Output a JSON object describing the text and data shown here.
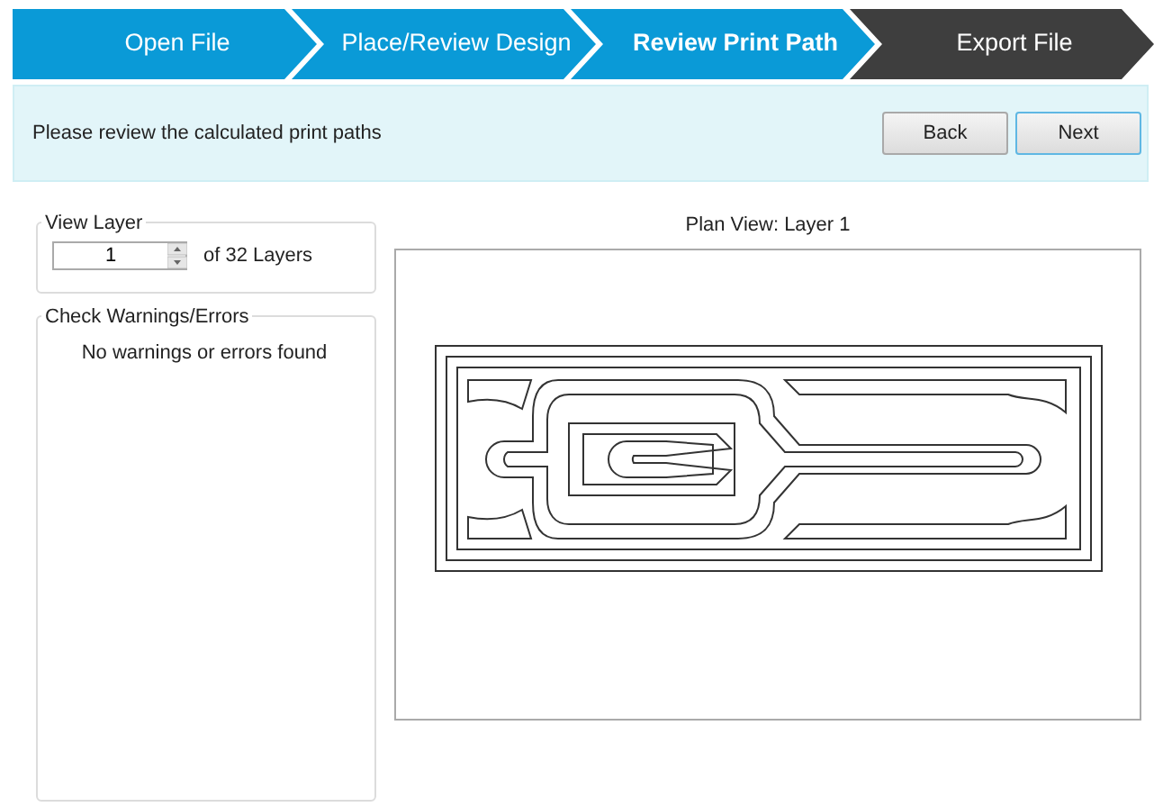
{
  "steps": [
    {
      "label": "Open File",
      "selected": false
    },
    {
      "label": "Place/Review Design",
      "selected": false
    },
    {
      "label": "Review Print Path",
      "selected": true
    },
    {
      "label": "Export File",
      "selected": false
    }
  ],
  "instruction": "Please review the calculated print paths",
  "buttons": [
    {
      "label": "Back",
      "selected": false
    },
    {
      "label": "Next",
      "selected": true
    }
  ],
  "view_layer": {
    "title": "View Layer",
    "value": "1",
    "suffix": "of 32 Layers"
  },
  "warnings": {
    "title": "Check Warnings/Errors",
    "message": "No warnings or errors found"
  },
  "plan_view": {
    "title": "Plan View: Layer 1"
  }
}
